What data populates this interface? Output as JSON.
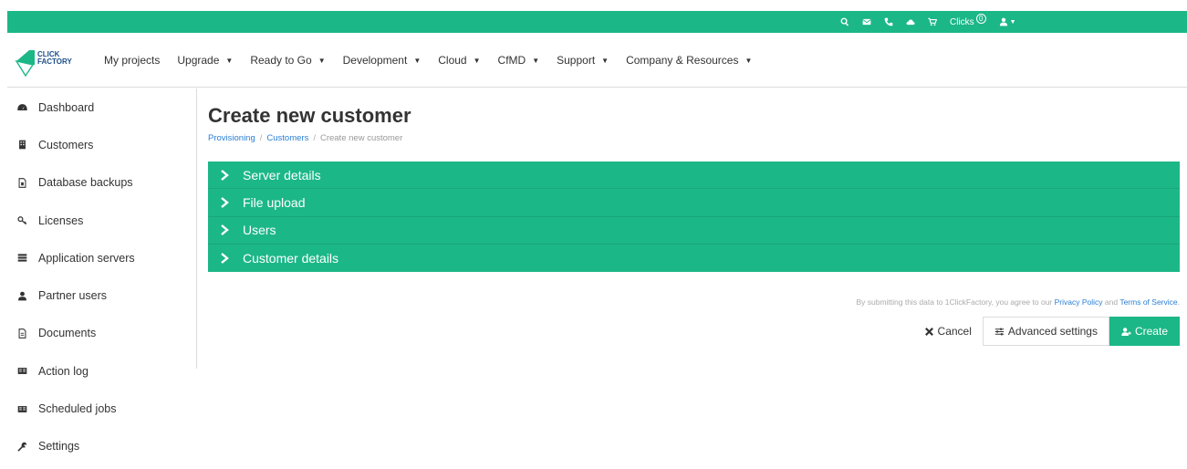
{
  "topbar": {
    "clicks_label": "Clicks",
    "clicks_count": "0",
    "icons": [
      "search-icon",
      "envelope-icon",
      "phone-icon",
      "cloud-icon",
      "cart-icon",
      "user-icon"
    ]
  },
  "logo": {
    "line1": "CLICK",
    "line2": "FACTORY"
  },
  "nav": {
    "items": [
      {
        "label": "My projects",
        "dropdown": false
      },
      {
        "label": "Upgrade",
        "dropdown": true
      },
      {
        "label": "Ready to Go",
        "dropdown": true
      },
      {
        "label": "Development",
        "dropdown": true
      },
      {
        "label": "Cloud",
        "dropdown": true
      },
      {
        "label": "CfMD",
        "dropdown": true
      },
      {
        "label": "Support",
        "dropdown": true
      },
      {
        "label": "Company & Resources",
        "dropdown": true
      }
    ]
  },
  "sidebar": {
    "items": [
      {
        "label": "Dashboard",
        "icon": "dashboard-icon"
      },
      {
        "label": "Customers",
        "icon": "building-icon"
      },
      {
        "label": "Database backups",
        "icon": "file-icon"
      },
      {
        "label": "Licenses",
        "icon": "key-icon"
      },
      {
        "label": "Application servers",
        "icon": "server-icon"
      },
      {
        "label": "Partner users",
        "icon": "user-icon"
      },
      {
        "label": "Documents",
        "icon": "document-icon"
      },
      {
        "label": "Action log",
        "icon": "list-icon"
      },
      {
        "label": "Scheduled jobs",
        "icon": "list-icon"
      },
      {
        "label": "Settings",
        "icon": "wrench-icon"
      }
    ]
  },
  "main": {
    "title": "Create new customer",
    "breadcrumb": [
      "Provisioning",
      "Customers",
      "Create new customer"
    ],
    "panels": [
      "Server details",
      "File upload",
      "Users",
      "Customer details"
    ],
    "terms": {
      "prefix": "By submitting this data to 1ClickFactory, you agree to our",
      "privacy": "Privacy Policy",
      "and": "and",
      "tos": "Terms of Service",
      "suffix": "."
    },
    "actions": {
      "cancel": "Cancel",
      "advanced": "Advanced settings",
      "create": "Create"
    }
  },
  "colors": {
    "accent": "#1cb787",
    "link": "#2a7fd4"
  }
}
